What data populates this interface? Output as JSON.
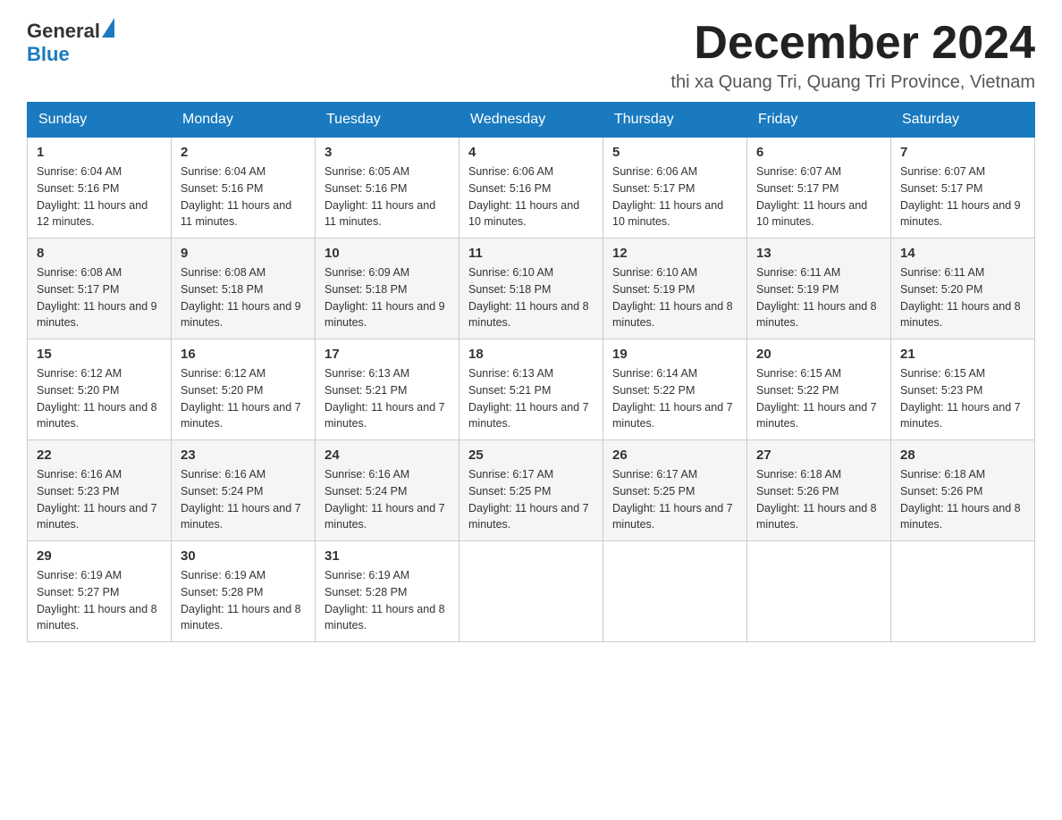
{
  "header": {
    "logo_general": "General",
    "logo_blue": "Blue",
    "month_title": "December 2024",
    "location": "thi xa Quang Tri, Quang Tri Province, Vietnam"
  },
  "days_of_week": [
    "Sunday",
    "Monday",
    "Tuesday",
    "Wednesday",
    "Thursday",
    "Friday",
    "Saturday"
  ],
  "weeks": [
    [
      {
        "day": "1",
        "sunrise": "6:04 AM",
        "sunset": "5:16 PM",
        "daylight": "11 hours and 12 minutes."
      },
      {
        "day": "2",
        "sunrise": "6:04 AM",
        "sunset": "5:16 PM",
        "daylight": "11 hours and 11 minutes."
      },
      {
        "day": "3",
        "sunrise": "6:05 AM",
        "sunset": "5:16 PM",
        "daylight": "11 hours and 11 minutes."
      },
      {
        "day": "4",
        "sunrise": "6:06 AM",
        "sunset": "5:16 PM",
        "daylight": "11 hours and 10 minutes."
      },
      {
        "day": "5",
        "sunrise": "6:06 AM",
        "sunset": "5:17 PM",
        "daylight": "11 hours and 10 minutes."
      },
      {
        "day": "6",
        "sunrise": "6:07 AM",
        "sunset": "5:17 PM",
        "daylight": "11 hours and 10 minutes."
      },
      {
        "day": "7",
        "sunrise": "6:07 AM",
        "sunset": "5:17 PM",
        "daylight": "11 hours and 9 minutes."
      }
    ],
    [
      {
        "day": "8",
        "sunrise": "6:08 AM",
        "sunset": "5:17 PM",
        "daylight": "11 hours and 9 minutes."
      },
      {
        "day": "9",
        "sunrise": "6:08 AM",
        "sunset": "5:18 PM",
        "daylight": "11 hours and 9 minutes."
      },
      {
        "day": "10",
        "sunrise": "6:09 AM",
        "sunset": "5:18 PM",
        "daylight": "11 hours and 9 minutes."
      },
      {
        "day": "11",
        "sunrise": "6:10 AM",
        "sunset": "5:18 PM",
        "daylight": "11 hours and 8 minutes."
      },
      {
        "day": "12",
        "sunrise": "6:10 AM",
        "sunset": "5:19 PM",
        "daylight": "11 hours and 8 minutes."
      },
      {
        "day": "13",
        "sunrise": "6:11 AM",
        "sunset": "5:19 PM",
        "daylight": "11 hours and 8 minutes."
      },
      {
        "day": "14",
        "sunrise": "6:11 AM",
        "sunset": "5:20 PM",
        "daylight": "11 hours and 8 minutes."
      }
    ],
    [
      {
        "day": "15",
        "sunrise": "6:12 AM",
        "sunset": "5:20 PM",
        "daylight": "11 hours and 8 minutes."
      },
      {
        "day": "16",
        "sunrise": "6:12 AM",
        "sunset": "5:20 PM",
        "daylight": "11 hours and 7 minutes."
      },
      {
        "day": "17",
        "sunrise": "6:13 AM",
        "sunset": "5:21 PM",
        "daylight": "11 hours and 7 minutes."
      },
      {
        "day": "18",
        "sunrise": "6:13 AM",
        "sunset": "5:21 PM",
        "daylight": "11 hours and 7 minutes."
      },
      {
        "day": "19",
        "sunrise": "6:14 AM",
        "sunset": "5:22 PM",
        "daylight": "11 hours and 7 minutes."
      },
      {
        "day": "20",
        "sunrise": "6:15 AM",
        "sunset": "5:22 PM",
        "daylight": "11 hours and 7 minutes."
      },
      {
        "day": "21",
        "sunrise": "6:15 AM",
        "sunset": "5:23 PM",
        "daylight": "11 hours and 7 minutes."
      }
    ],
    [
      {
        "day": "22",
        "sunrise": "6:16 AM",
        "sunset": "5:23 PM",
        "daylight": "11 hours and 7 minutes."
      },
      {
        "day": "23",
        "sunrise": "6:16 AM",
        "sunset": "5:24 PM",
        "daylight": "11 hours and 7 minutes."
      },
      {
        "day": "24",
        "sunrise": "6:16 AM",
        "sunset": "5:24 PM",
        "daylight": "11 hours and 7 minutes."
      },
      {
        "day": "25",
        "sunrise": "6:17 AM",
        "sunset": "5:25 PM",
        "daylight": "11 hours and 7 minutes."
      },
      {
        "day": "26",
        "sunrise": "6:17 AM",
        "sunset": "5:25 PM",
        "daylight": "11 hours and 7 minutes."
      },
      {
        "day": "27",
        "sunrise": "6:18 AM",
        "sunset": "5:26 PM",
        "daylight": "11 hours and 8 minutes."
      },
      {
        "day": "28",
        "sunrise": "6:18 AM",
        "sunset": "5:26 PM",
        "daylight": "11 hours and 8 minutes."
      }
    ],
    [
      {
        "day": "29",
        "sunrise": "6:19 AM",
        "sunset": "5:27 PM",
        "daylight": "11 hours and 8 minutes."
      },
      {
        "day": "30",
        "sunrise": "6:19 AM",
        "sunset": "5:28 PM",
        "daylight": "11 hours and 8 minutes."
      },
      {
        "day": "31",
        "sunrise": "6:19 AM",
        "sunset": "5:28 PM",
        "daylight": "11 hours and 8 minutes."
      },
      null,
      null,
      null,
      null
    ]
  ],
  "labels": {
    "sunrise_prefix": "Sunrise: ",
    "sunset_prefix": "Sunset: ",
    "daylight_prefix": "Daylight: "
  }
}
